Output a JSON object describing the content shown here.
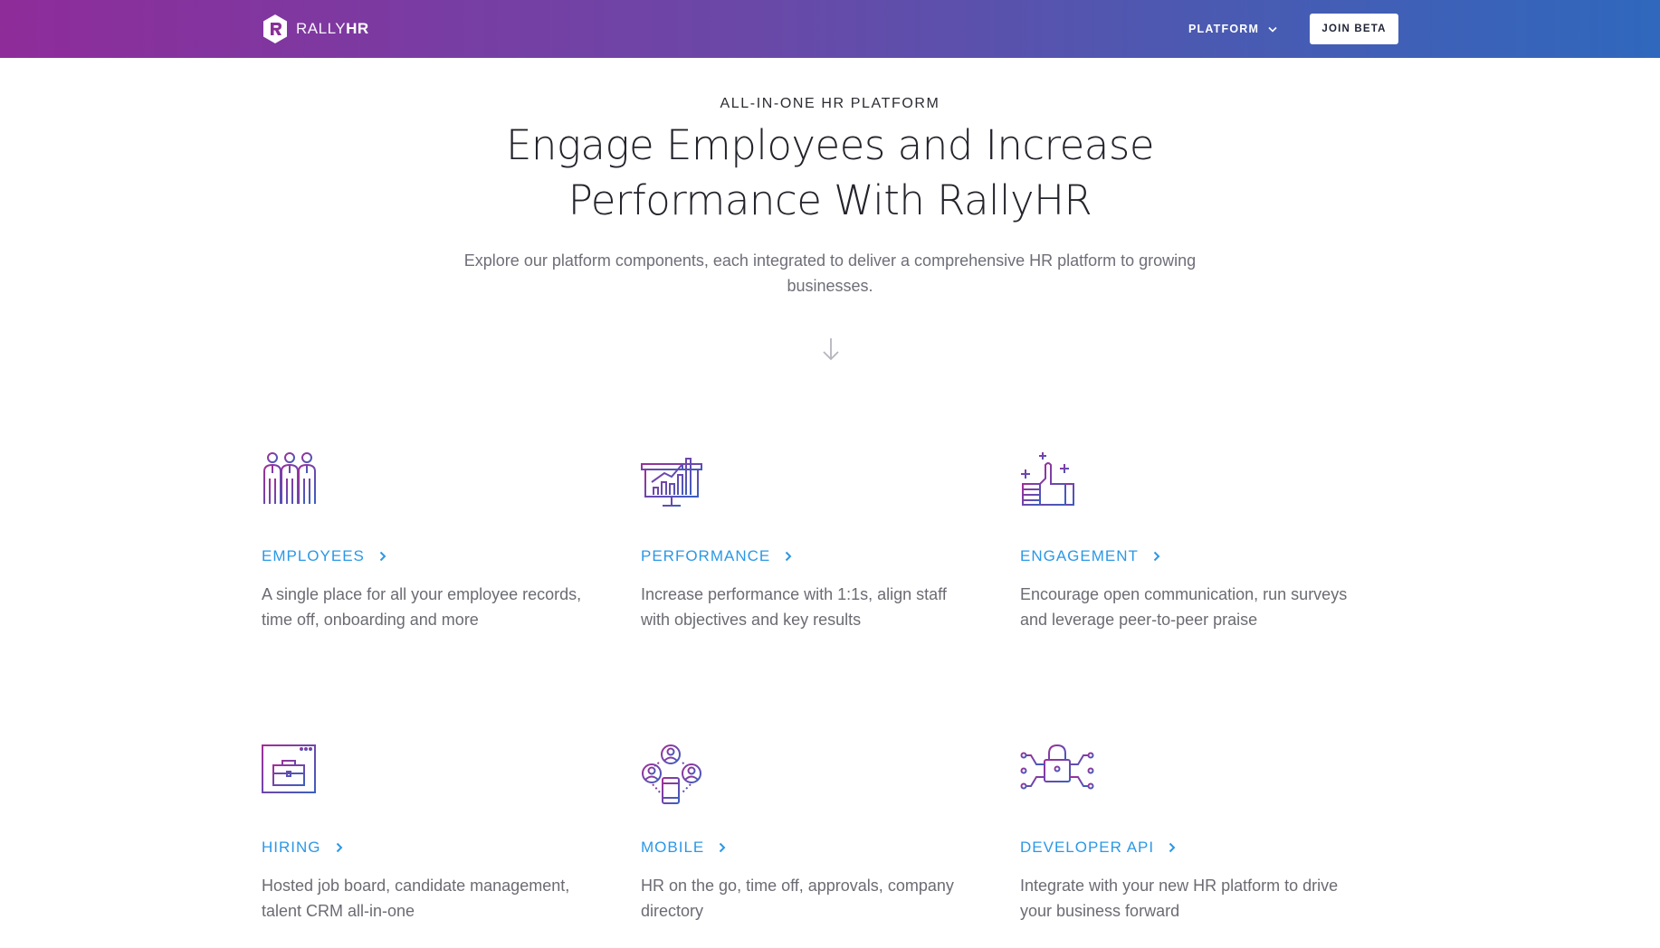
{
  "header": {
    "brand_light": "RALLY",
    "brand_bold": "HR",
    "nav_platform_label": "PLATFORM",
    "join_label": "JOIN BETA"
  },
  "hero": {
    "eyebrow": "ALL-IN-ONE HR PLATFORM",
    "headline_line1": "Engage Employees and Increase",
    "headline_line2": "Performance With RallyHR",
    "subtext": "Explore our platform components, each integrated to deliver a comprehensive HR platform to growing businesses."
  },
  "features": [
    {
      "title": "EMPLOYEES",
      "desc": "A single place for all your employee records, time off, onboarding and more",
      "icon": "employees-icon"
    },
    {
      "title": "PERFORMANCE",
      "desc": "Increase performance with 1:1s, align staff with objectives and key results",
      "icon": "performance-chart-icon"
    },
    {
      "title": "ENGAGEMENT",
      "desc": "Encourage open communication, run surveys and leverage peer-to-peer praise",
      "icon": "thumbs-up-icon"
    },
    {
      "title": "HIRING",
      "desc": "Hosted job board, candidate management, talent CRM all-in-one",
      "icon": "briefcase-window-icon"
    },
    {
      "title": "MOBILE",
      "desc": "HR on the go, time off, approvals, company directory",
      "icon": "mobile-network-icon"
    },
    {
      "title": "DEVELOPER API",
      "desc": "Integrate with your new HR platform to drive your business forward",
      "icon": "lock-circuit-icon"
    }
  ],
  "colors": {
    "gradient_start": "#8e2c9a",
    "gradient_end": "#2f68bd",
    "link_blue": "#2b98e6"
  }
}
